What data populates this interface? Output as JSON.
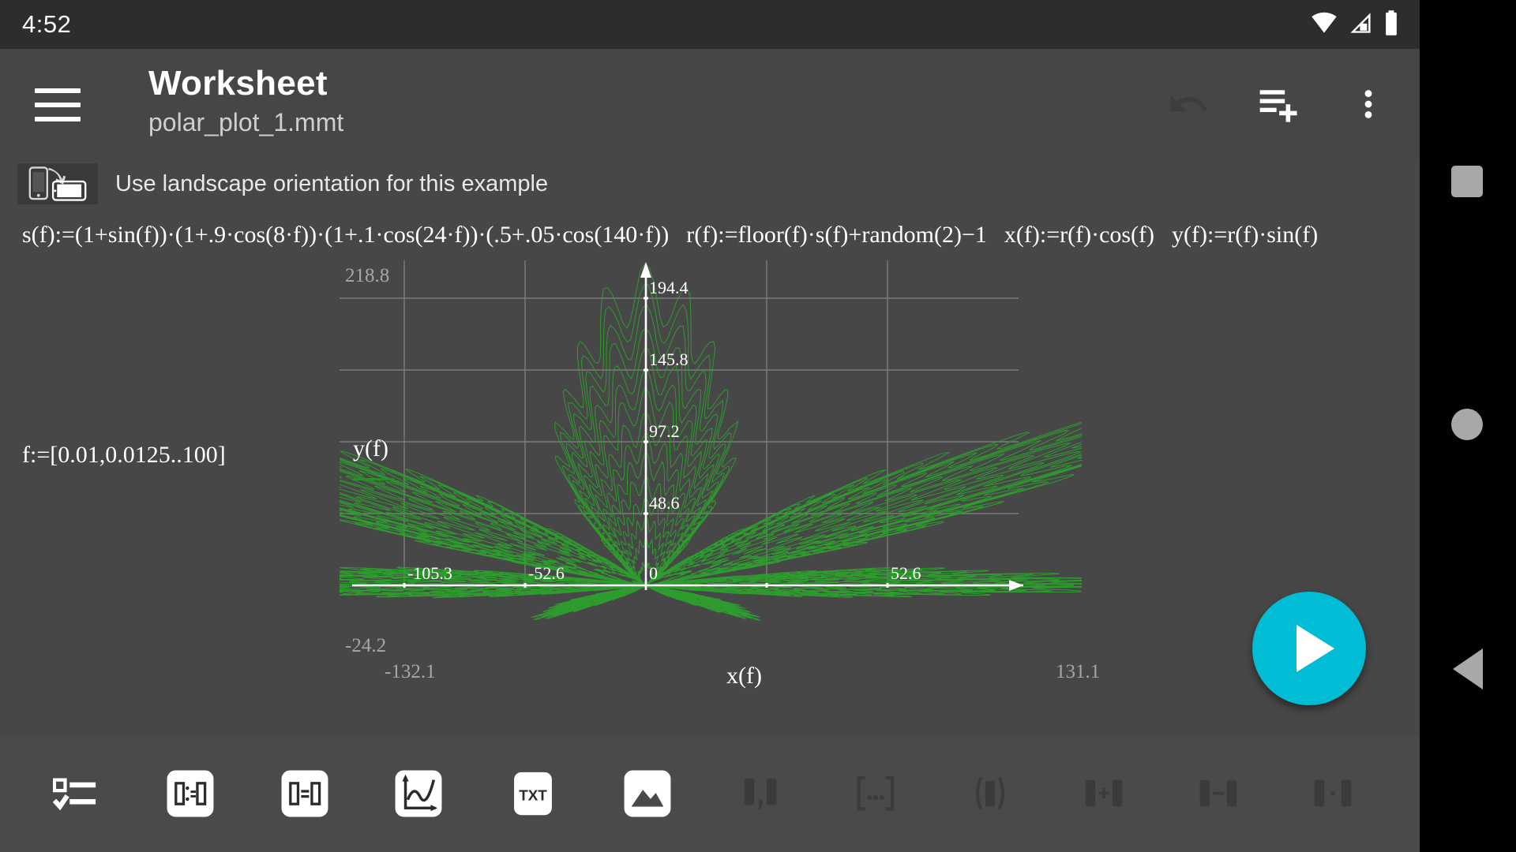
{
  "statusbar": {
    "time": "4:52",
    "icons": [
      "wifi-icon",
      "cell-signal-icon",
      "battery-icon"
    ]
  },
  "appbar": {
    "menu_icon": "hamburger-menu-icon",
    "title": "Worksheet",
    "subtitle": "polar_plot_1.mmt",
    "actions": [
      {
        "name": "undo-button",
        "icon": "undo-icon",
        "enabled": false
      },
      {
        "name": "add-formula-button",
        "icon": "list-add-icon",
        "enabled": true
      },
      {
        "name": "overflow-menu-button",
        "icon": "more-vertical-icon",
        "enabled": true
      }
    ]
  },
  "hint": {
    "icon": "rotate-device-icon",
    "text": "Use landscape orientation for this example"
  },
  "formulas": {
    "s_def": "s(f):=(1+sin(f))·(1+.9·cos(8·f))·(1+.1·cos(24·f))·(.5+.05·cos(140·f))",
    "r_def": "r(f):=floor(f)·s(f)+random(2)−1",
    "x_def": "x(f):=r(f)·cos(f)",
    "y_def": "y(f):=r(f)·sin(f)",
    "f_range": "f:=[0.01,0.0125..100]"
  },
  "chart_data": {
    "type": "line",
    "title": "",
    "xlabel": "x(f)",
    "ylabel": "y(f)",
    "series_color": "#2ca02c",
    "grid": true,
    "legend": "none",
    "xlim": [
      -132.1,
      131.1
    ],
    "ylim": [
      -24.2,
      218.8
    ],
    "x_ticks": [
      -105.3,
      -52.6,
      0,
      52.6
    ],
    "y_ticks": [
      48.6,
      97.2,
      145.8,
      194.4
    ],
    "x_tick_labels": [
      "-105.3",
      "-52.6",
      "0",
      "52.6"
    ],
    "y_tick_labels": [
      "48.6",
      "97.2",
      "145.8",
      "194.4"
    ],
    "corner_labels": {
      "top_left_y": "218.8",
      "bottom_left_y": "-24.2",
      "bottom_left_x": "-132.1",
      "bottom_right_x": "131.1"
    },
    "description": "Polar plot of x(f)=r(f)cos(f), y(f)=r(f)sin(f) forming a green cannabis-leaf shaped curve with seven lobes",
    "parametric": {
      "s": "(1+sin(f))*(1+0.9*cos(8*f))*(1+0.1*cos(24*f))*(0.5+0.05*cos(140*f))",
      "r": "floor(f)*s(f)+random(2)-1",
      "x": "r(f)*cos(f)",
      "y": "r(f)*sin(f)",
      "f_from": 0.01,
      "f_step": 0.0025,
      "f_to": 100
    }
  },
  "fab": {
    "name": "run-button",
    "icon": "play-icon",
    "color": "#00bcd4"
  },
  "bottom_toolbar": [
    {
      "name": "tool-checklist",
      "icon": "checklist-icon",
      "enabled": true
    },
    {
      "name": "tool-assign-result",
      "icon": "assign-result-icon",
      "enabled": true
    },
    {
      "name": "tool-equation",
      "icon": "equation-icon",
      "enabled": true
    },
    {
      "name": "tool-plot",
      "icon": "plot-icon",
      "enabled": true
    },
    {
      "name": "tool-text",
      "icon": "txt-icon",
      "enabled": true
    },
    {
      "name": "tool-image",
      "icon": "image-icon",
      "enabled": true
    },
    {
      "name": "tool-comma",
      "icon": "comma-separator-icon",
      "enabled": false
    },
    {
      "name": "tool-brackets",
      "icon": "brackets-ellipsis-icon",
      "enabled": false
    },
    {
      "name": "tool-parentheses",
      "icon": "parentheses-icon",
      "enabled": false
    },
    {
      "name": "tool-plus",
      "icon": "plus-operator-icon",
      "enabled": false
    },
    {
      "name": "tool-minus",
      "icon": "minus-operator-icon",
      "enabled": false
    },
    {
      "name": "tool-multiply",
      "icon": "multiply-operator-icon",
      "enabled": false
    }
  ],
  "navbar": [
    {
      "name": "nav-recents-button",
      "icon": "square-icon"
    },
    {
      "name": "nav-home-button",
      "icon": "circle-icon"
    },
    {
      "name": "nav-back-button",
      "icon": "triangle-back-icon"
    }
  ]
}
